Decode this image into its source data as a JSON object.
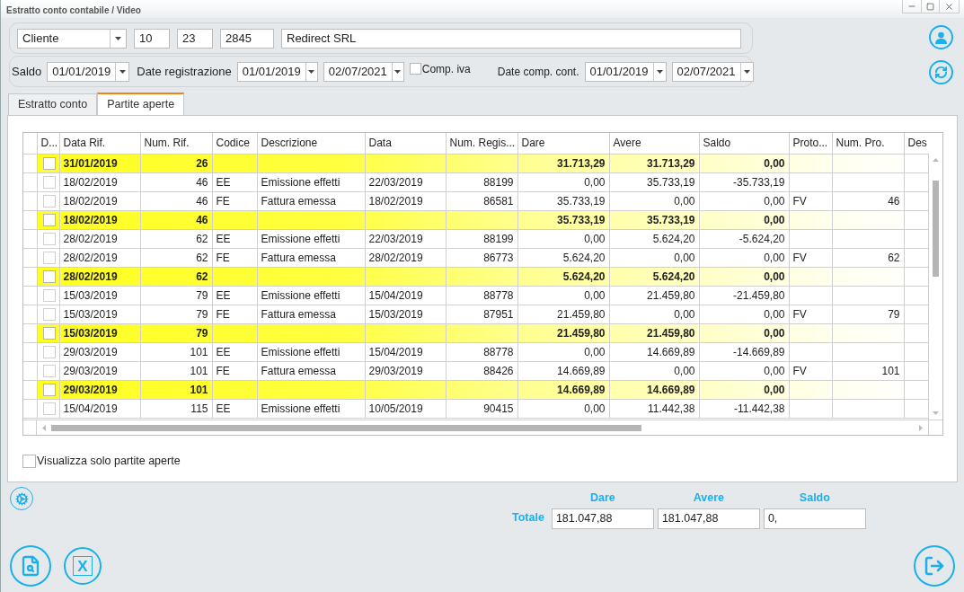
{
  "window": {
    "title": "Estratto conto contabile / Video"
  },
  "account": {
    "type_select": "Cliente",
    "codes": [
      "10",
      "23",
      "2845"
    ],
    "name": "Redirect SRL"
  },
  "dates": {
    "saldo": {
      "label": "Saldo",
      "value": "01/01/2019"
    },
    "registrazione": {
      "label": "Date registrazione",
      "from": "01/01/2019",
      "to": "02/07/2021"
    },
    "comp_iva": {
      "label": "Comp. iva",
      "checked": false
    },
    "comp_cont": {
      "label": "Date comp. cont.",
      "from": "01/01/2019",
      "to": "02/07/2021"
    }
  },
  "tabs": [
    {
      "label": "Estratto conto",
      "selected": false
    },
    {
      "label": "Partite aperte",
      "selected": true
    }
  ],
  "table": {
    "columns": [
      "D...",
      "Data Rif.",
      "Num. Rif.",
      "Codice",
      "Descrizione",
      "Data",
      "Num. Regis...",
      "Dare",
      "Avere",
      "Saldo",
      "Proto...",
      "Num. Pro.",
      "Des"
    ],
    "rows": [
      {
        "kind": "group",
        "checked": false,
        "data_rif": "31/01/2019",
        "num_rif": "26",
        "dare": "31.713,29",
        "avere": "31.713,29",
        "saldo": "0,00"
      },
      {
        "kind": "line",
        "checked": false,
        "data_rif": "18/02/2019",
        "num_rif": "46",
        "codice": "EE",
        "descrizione": "Emissione effetti",
        "data": "22/03/2019",
        "num_reg": "88199",
        "dare": "0,00",
        "avere": "35.733,19",
        "saldo": "-35.733,19"
      },
      {
        "kind": "line",
        "checked": false,
        "data_rif": "18/02/2019",
        "num_rif": "46",
        "codice": "FE",
        "descrizione": "Fattura emessa",
        "data": "18/02/2019",
        "num_reg": "86581",
        "dare": "35.733,19",
        "avere": "0,00",
        "saldo": "0,00",
        "proto": "FV",
        "num_pro": "46"
      },
      {
        "kind": "group",
        "checked": false,
        "data_rif": "18/02/2019",
        "num_rif": "46",
        "dare": "35.733,19",
        "avere": "35.733,19",
        "saldo": "0,00"
      },
      {
        "kind": "line",
        "checked": false,
        "data_rif": "28/02/2019",
        "num_rif": "62",
        "codice": "EE",
        "descrizione": "Emissione effetti",
        "data": "22/03/2019",
        "num_reg": "88199",
        "dare": "0,00",
        "avere": "5.624,20",
        "saldo": "-5.624,20"
      },
      {
        "kind": "line",
        "checked": false,
        "data_rif": "28/02/2019",
        "num_rif": "62",
        "codice": "FE",
        "descrizione": "Fattura emessa",
        "data": "28/02/2019",
        "num_reg": "86773",
        "dare": "5.624,20",
        "avere": "0,00",
        "saldo": "0,00",
        "proto": "FV",
        "num_pro": "62"
      },
      {
        "kind": "group",
        "checked": false,
        "data_rif": "28/02/2019",
        "num_rif": "62",
        "dare": "5.624,20",
        "avere": "5.624,20",
        "saldo": "0,00"
      },
      {
        "kind": "line",
        "checked": false,
        "data_rif": "15/03/2019",
        "num_rif": "79",
        "codice": "EE",
        "descrizione": "Emissione effetti",
        "data": "15/04/2019",
        "num_reg": "88778",
        "dare": "0,00",
        "avere": "21.459,80",
        "saldo": "-21.459,80"
      },
      {
        "kind": "line",
        "checked": false,
        "data_rif": "15/03/2019",
        "num_rif": "79",
        "codice": "FE",
        "descrizione": "Fattura emessa",
        "data": "15/03/2019",
        "num_reg": "87951",
        "dare": "21.459,80",
        "avere": "0,00",
        "saldo": "0,00",
        "proto": "FV",
        "num_pro": "79"
      },
      {
        "kind": "group",
        "checked": false,
        "data_rif": "15/03/2019",
        "num_rif": "79",
        "dare": "21.459,80",
        "avere": "21.459,80",
        "saldo": "0,00"
      },
      {
        "kind": "line",
        "checked": false,
        "data_rif": "29/03/2019",
        "num_rif": "101",
        "codice": "EE",
        "descrizione": "Emissione effetti",
        "data": "15/04/2019",
        "num_reg": "88778",
        "dare": "0,00",
        "avere": "14.669,89",
        "saldo": "-14.669,89"
      },
      {
        "kind": "line",
        "checked": false,
        "data_rif": "29/03/2019",
        "num_rif": "101",
        "codice": "FE",
        "descrizione": "Fattura emessa",
        "data": "29/03/2019",
        "num_reg": "88426",
        "dare": "14.669,89",
        "avere": "0,00",
        "saldo": "0,00",
        "proto": "FV",
        "num_pro": "101"
      },
      {
        "kind": "group",
        "checked": false,
        "data_rif": "29/03/2019",
        "num_rif": "101",
        "dare": "14.669,89",
        "avere": "14.669,89",
        "saldo": "0,00"
      },
      {
        "kind": "line",
        "checked": false,
        "data_rif": "15/04/2019",
        "num_rif": "115",
        "codice": "EE",
        "descrizione": "Emissione effetti",
        "data": "10/05/2019",
        "num_reg": "90415",
        "dare": "0,00",
        "avere": "11.442,38",
        "saldo": "-11.442,38"
      }
    ]
  },
  "only_open": {
    "label": "Visualizza solo partite aperte",
    "checked": false
  },
  "totals": {
    "label": "Totale",
    "fields": [
      {
        "label": "Dare",
        "value": "181.047,88"
      },
      {
        "label": "Avere",
        "value": "181.047,88"
      },
      {
        "label": "Saldo",
        "value": "0,"
      }
    ]
  },
  "excel_button": {
    "glyph": "X"
  }
}
